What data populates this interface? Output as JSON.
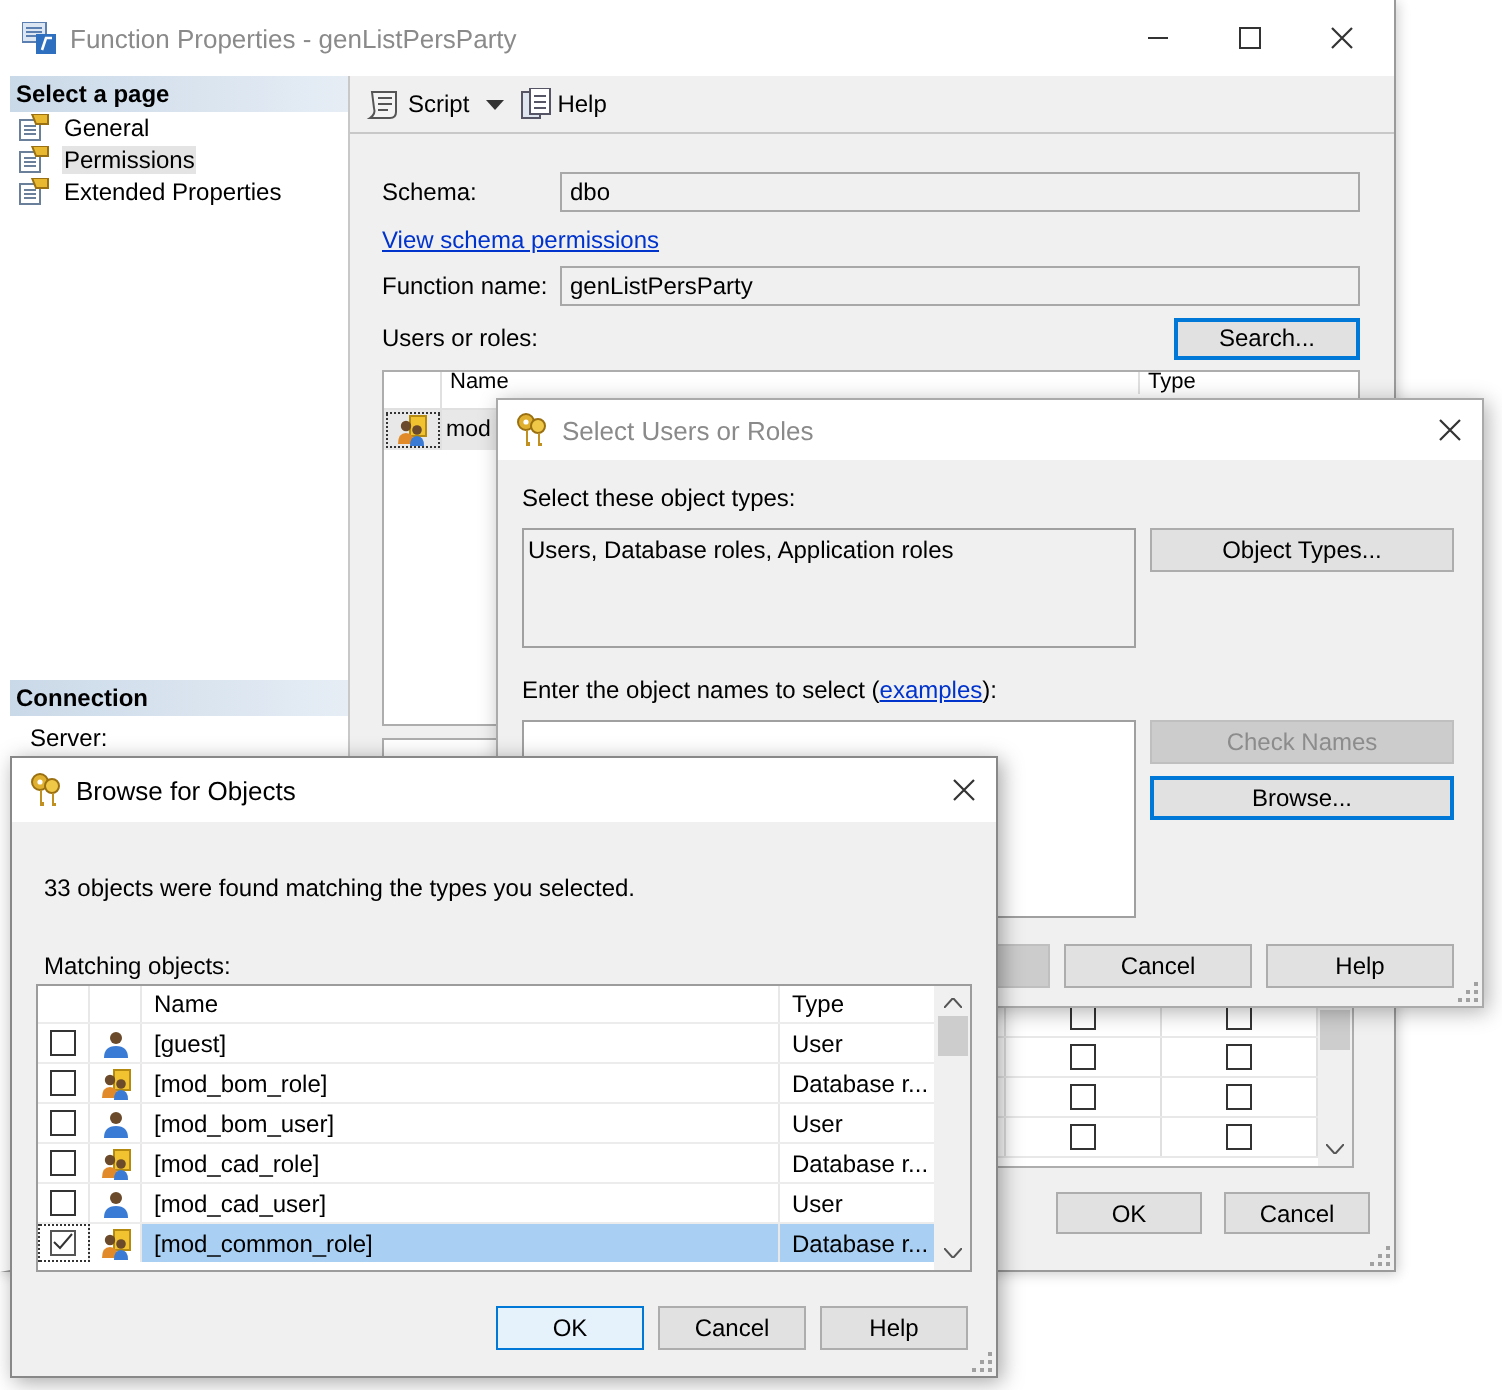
{
  "main_window": {
    "title": "Function Properties - genListPersParty",
    "sidebar": {
      "header": "Select a page",
      "items": [
        {
          "label": "General",
          "selected": false
        },
        {
          "label": "Permissions",
          "selected": true
        },
        {
          "label": "Extended Properties",
          "selected": false
        }
      ],
      "connection_header": "Connection",
      "connection_label": "Server:"
    },
    "toolbar": [
      {
        "label": "Script",
        "kind": "script"
      },
      {
        "label": "Help",
        "kind": "help"
      }
    ],
    "form": {
      "schema_label": "Schema:",
      "schema": "dbo",
      "schema_link": "View schema permissions",
      "function_label": "Function name:",
      "function_name": "genListPersParty",
      "users_label": "Users or roles:",
      "search_button": "Search..."
    },
    "users_table": {
      "columns": [
        "Name",
        "Type"
      ],
      "rows": [
        {
          "name": "mod",
          "kind": "role",
          "selected": true
        }
      ]
    },
    "permissions_table": {
      "rows": [
        {
          "grant": false,
          "with_grant": false
        },
        {
          "grant": false,
          "with_grant": false
        },
        {
          "grant": false,
          "with_grant": false
        },
        {
          "grant": false,
          "with_grant": false
        }
      ]
    },
    "buttons": [
      "OK",
      "Cancel"
    ]
  },
  "select_dialog": {
    "title": "Select Users or Roles",
    "types_label": "Select these object types:",
    "types": "Users, Database roles, Application roles",
    "object_types_button": "Object Types...",
    "names_label_before": "Enter the object names to select (",
    "names_link": "examples",
    "names_label_after": "):",
    "check_names_button": {
      "label": "Check Names",
      "disabled": true
    },
    "browse_button": "Browse...",
    "buttons": [
      "Cancel",
      "Help"
    ]
  },
  "browse_dialog": {
    "title": "Browse for Objects",
    "message": "33 objects were found matching the types you selected.",
    "list_label": "Matching objects:",
    "columns": [
      "Name",
      "Type"
    ],
    "rows": [
      {
        "name": "[guest]",
        "type": "User",
        "kind": "user",
        "checked": false,
        "selected": false
      },
      {
        "name": "[mod_bom_role]",
        "type": "Database r...",
        "kind": "role",
        "checked": false,
        "selected": false
      },
      {
        "name": "[mod_bom_user]",
        "type": "User",
        "kind": "user",
        "checked": false,
        "selected": false
      },
      {
        "name": "[mod_cad_role]",
        "type": "Database r...",
        "kind": "role",
        "checked": false,
        "selected": false
      },
      {
        "name": "[mod_cad_user]",
        "type": "User",
        "kind": "user",
        "checked": false,
        "selected": false
      },
      {
        "name": "[mod_common_role]",
        "type": "Database r...",
        "kind": "role",
        "checked": true,
        "selected": true
      }
    ],
    "buttons": [
      {
        "label": "OK",
        "default": true
      },
      {
        "label": "Cancel",
        "default": false
      },
      {
        "label": "Help",
        "default": false
      }
    ]
  }
}
